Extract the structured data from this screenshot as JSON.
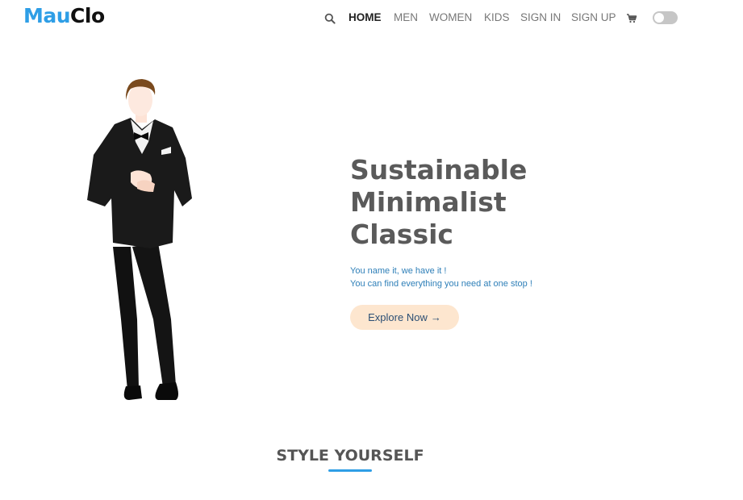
{
  "brand": {
    "part1": "Mau",
    "part2": "Clo",
    "color1": "#2e9ee6",
    "color2": "#111111"
  },
  "nav": {
    "search_icon": "search-icon",
    "links": [
      {
        "label": "HOME",
        "active": true
      },
      {
        "label": "MEN"
      },
      {
        "label": "WOMEN"
      },
      {
        "label": "KIDS"
      },
      {
        "label": "SIGN IN"
      },
      {
        "label": "SIGN UP"
      }
    ],
    "cart_icon": "cart-icon",
    "theme_toggle": "dark-mode-toggle"
  },
  "hero": {
    "title_lines": [
      "Sustainable",
      "Minimalist",
      "Classic"
    ],
    "subtitle_lines": [
      "You name it, we have it !",
      "You can find everything you need at one stop !"
    ],
    "cta_label": "Explore Now",
    "cta_icon": "→",
    "illustration": "man-in-tuxedo"
  },
  "section": {
    "title": "STYLE YOURSELF",
    "accent": "#2e9ee6"
  }
}
